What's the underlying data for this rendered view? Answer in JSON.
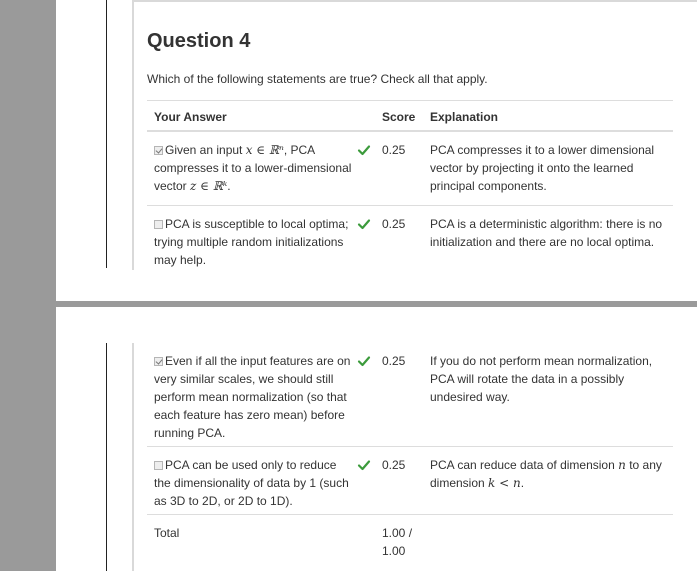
{
  "question": {
    "title": "Question 4",
    "prompt": "Which of the following statements are true? Check all that apply."
  },
  "table": {
    "headers": {
      "answer": "Your Answer",
      "score": "Score",
      "explanation": "Explanation"
    },
    "rows": [
      {
        "checked": true,
        "answer_pre": "Given an input ",
        "answer_math1": "x ∈ ℝⁿ",
        "answer_mid": ", PCA compresses it to a lower-dimensional vector ",
        "answer_math2": "z ∈ ℝᵏ",
        "answer_post": ".",
        "correct_icon": "check-icon",
        "score": "0.25",
        "explanation": "PCA compresses it to a lower dimensional vector by projecting it onto the learned principal components."
      },
      {
        "checked": false,
        "answer": "PCA is susceptible to local optima; trying multiple random initializations may help.",
        "correct_icon": "check-icon",
        "score": "0.25",
        "explanation": "PCA is a deterministic algorithm: there is no initialization and there are no local optima."
      },
      {
        "checked": true,
        "answer": "Even if all the input features are on very similar scales, we should still perform mean normalization (so that each feature has zero mean) before running PCA.",
        "correct_icon": "check-icon",
        "score": "0.25",
        "explanation": "If you do not perform mean normalization, PCA will rotate the data in a possibly undesired way."
      },
      {
        "checked": false,
        "answer": "PCA can be used only to reduce the dimensionality of data by 1 (such as 3D to 2D, or 2D to 1D).",
        "correct_icon": "check-icon",
        "score": "0.25",
        "explanation_pre": "PCA can reduce data of dimension ",
        "explanation_math1": "n",
        "explanation_mid": " to any dimension ",
        "explanation_math2": "k < n",
        "explanation_post": "."
      }
    ],
    "total": {
      "label": "Total",
      "score": "1.00 / 1.00"
    }
  },
  "colors": {
    "check": "#3c9b3c",
    "sidebar": "#9a9a9a",
    "border": "#dddddd"
  }
}
